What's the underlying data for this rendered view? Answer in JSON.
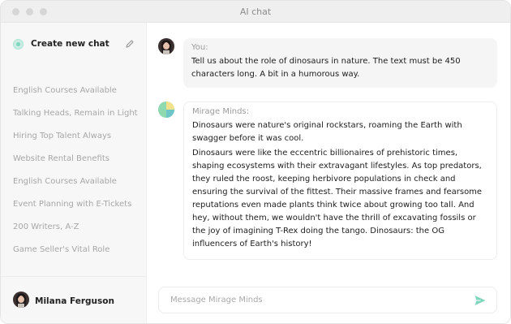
{
  "window": {
    "title": "AI chat"
  },
  "sidebar": {
    "new_chat_label": "Create new chat",
    "chats": [
      "English Courses Available",
      "Talking Heads, Remain in Light",
      "Hiring Top Talent Always",
      "Website Rental Benefits",
      "English Courses Available",
      "Event Planning with E-Tickets",
      "200 Writers, A-Z",
      "Game Seller's Vital Role"
    ],
    "user": {
      "name": "Milana Ferguson"
    }
  },
  "conversation": {
    "user_message": {
      "sender": "You:",
      "text": "Tell us about the role of dinosaurs in nature. The text must be 450 characters long. A bit in a humorous way."
    },
    "ai_message": {
      "sender": "Mirage Minds:",
      "paragraphs": [
        "Dinosaurs were nature's original rockstars, roaming the Earth with swagger before it was cool.",
        "Dinosaurs were like the eccentric billionaires of prehistoric times, shaping ecosystems with their extravagant lifestyles. As top predators, they ruled the roost, keeping herbivore populations in check and ensuring the survival of the fittest. Their massive frames and fearsome reputations even made plants think twice about growing too tall. And hey, without them, we wouldn't have the thrill of excavating fossils or the joy of imagining T-Rex doing the tango. Dinosaurs: the OG influencers of Earth's history!"
      ]
    }
  },
  "composer": {
    "placeholder": "Message Mirage Minds",
    "value": ""
  },
  "colors": {
    "accent": "#7fd6bd",
    "ai_avatar_green": "#8ed9b0",
    "ai_avatar_yellow": "#f3e08a",
    "ai_avatar_teal": "#6fc6c9"
  },
  "icons": {
    "new_chat": "teal-circle-icon",
    "edit": "pencil-icon",
    "send": "paper-plane-icon"
  }
}
